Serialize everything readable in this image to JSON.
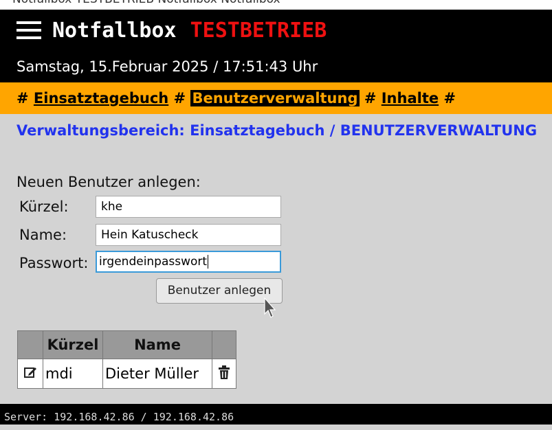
{
  "top_strip": {
    "text": "Notfallbox TESTBETRIEB   Notfallbox   Notfallbox"
  },
  "header": {
    "title": "Notfallbox",
    "mode": "TESTBETRIEB"
  },
  "datetime": "Samstag, 15.Februar 2025 / 17:51:43 Uhr",
  "nav": {
    "sep": "#",
    "items": [
      {
        "label": "Einsatztagebuch",
        "active": false
      },
      {
        "label": "Benutzerverwaltung",
        "active": true
      },
      {
        "label": "Inhalte",
        "active": false
      }
    ]
  },
  "section_title": "Verwaltungsbereich: Einsatztagebuch / BENUTZERVERWALTUNG",
  "form": {
    "heading": "Neuen Benutzer anlegen:",
    "kuerzel_label": "Kürzel:",
    "kuerzel_value": "khe",
    "name_label": "Name:",
    "name_value": "Hein Katuscheck",
    "passwort_label": "Passwort:",
    "passwort_value": "irgendeinpasswort",
    "submit_label": "Benutzer anlegen"
  },
  "table": {
    "headers": [
      "",
      "Kürzel",
      "Name",
      ""
    ],
    "rows": [
      {
        "kuerzel": "mdi",
        "name": "Dieter Müller"
      }
    ]
  },
  "footer": {
    "server": "Server: 192.168.42.86 / 192.168.42.86"
  },
  "icons": {
    "menu": "hamburger-icon",
    "edit": "edit-icon",
    "delete": "trash-icon",
    "cursor": "mouse-pointer-icon"
  },
  "colors": {
    "nav_bg": "#ffa500",
    "mode_red": "#ee1111",
    "section_blue": "#2233ee"
  }
}
